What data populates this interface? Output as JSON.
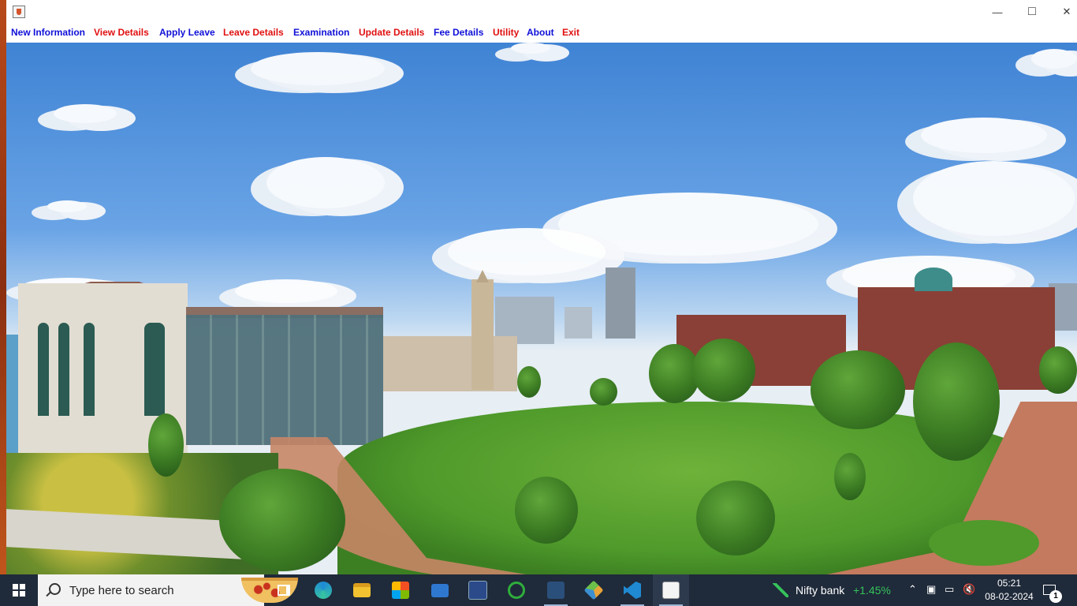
{
  "window": {
    "minimize_icon": "minimize-icon",
    "maximize_icon": "maximize-icon",
    "close_icon": "close-icon",
    "minimize_glyph": "—",
    "maximize_glyph": "□",
    "close_glyph": "✕"
  },
  "menubar": {
    "items": [
      {
        "label": "New Information",
        "color": "#1010d8"
      },
      {
        "label": "View Details",
        "color": "#e01010"
      },
      {
        "label": "Apply Leave",
        "color": "#1010d8"
      },
      {
        "label": "Leave Details",
        "color": "#e01010"
      },
      {
        "label": "Examination",
        "color": "#1010d8"
      },
      {
        "label": "Update Details",
        "color": "#e01010"
      },
      {
        "label": "Fee Details",
        "color": "#1010d8"
      },
      {
        "label": "Utility",
        "color": "#e01010"
      },
      {
        "label": "About",
        "color": "#1010d8"
      },
      {
        "label": "Exit",
        "color": "#e01010"
      }
    ]
  },
  "taskbar": {
    "search_placeholder": "Type here to search",
    "apps": [
      "task-view",
      "edge",
      "file-explorer",
      "microsoft-store",
      "mail",
      "dev-c++",
      "app-green-ring",
      "mysql-workbench",
      "app-cube",
      "visual-studio-code",
      "java-app"
    ],
    "stock_name": "Nifty bank",
    "stock_change": "+1.45%",
    "time": "05:21",
    "date": "08-02-2024",
    "notification_count": "1"
  }
}
